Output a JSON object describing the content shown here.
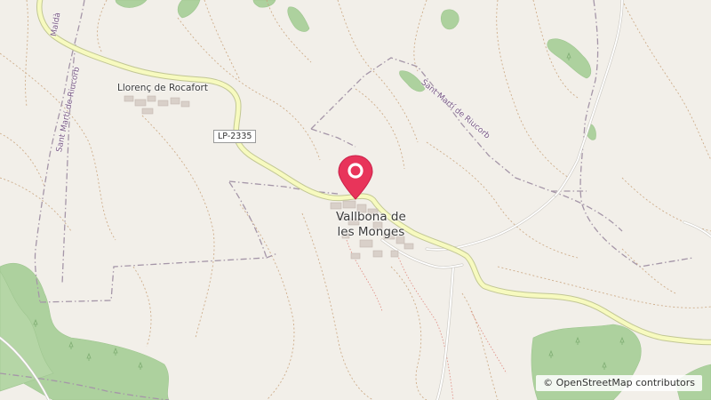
{
  "map": {
    "places": {
      "town_line1": "Vallbona de",
      "town_line2": "les Monges",
      "village": "Llorenç de Rocafort"
    },
    "boundary_labels": {
      "malda": "Maldà",
      "sant_marti_left": "Sant Martí de Riucorb",
      "sant_marti_right": "Sant Martí de Riucorb"
    },
    "road_ref": "LP-2335",
    "attribution": "© OpenStreetMap contributors",
    "colors": {
      "background": "#f2efe9",
      "forest": "#add19e",
      "road_fill": "#f7fabf",
      "road_casing": "#c2c794",
      "boundary": "#9e8fa6",
      "track": "#c8a27a",
      "marker": "#e8345a"
    },
    "marker_icon": "map-pin-icon"
  }
}
